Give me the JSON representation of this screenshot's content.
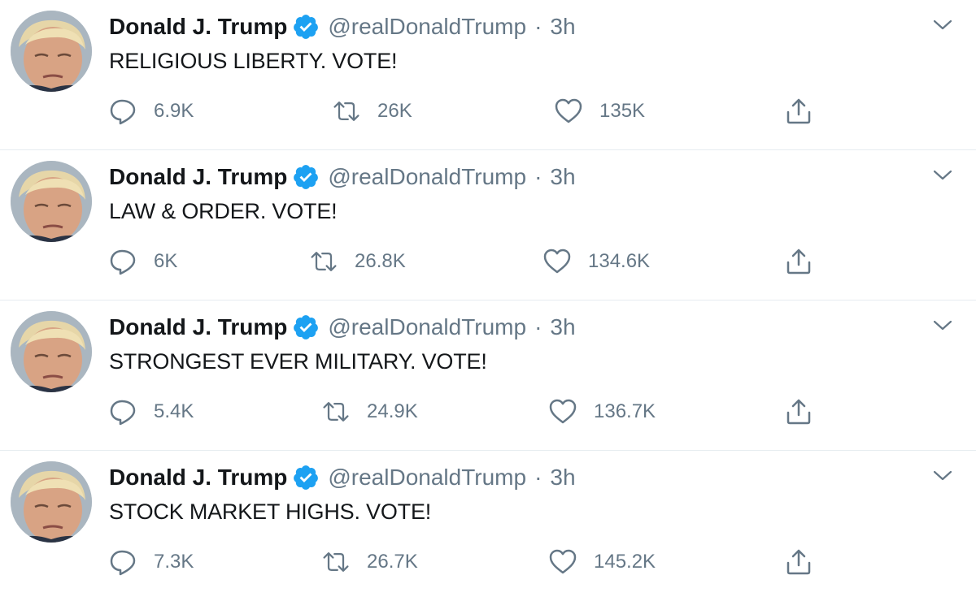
{
  "colors": {
    "text": "#14171a",
    "secondary": "#657786",
    "verified": "#1da1f2",
    "divider": "#e6ecf0"
  },
  "tweets": [
    {
      "name": "Donald J. Trump",
      "handle": "@realDonaldTrump",
      "separator": "·",
      "time": "3h",
      "text": "RELIGIOUS LIBERTY. VOTE!",
      "replies": "6.9K",
      "retweets": "26K",
      "likes": "135K"
    },
    {
      "name": "Donald J. Trump",
      "handle": "@realDonaldTrump",
      "separator": "·",
      "time": "3h",
      "text": "LAW & ORDER. VOTE!",
      "replies": "6K",
      "retweets": "26.8K",
      "likes": "134.6K"
    },
    {
      "name": "Donald J. Trump",
      "handle": "@realDonaldTrump",
      "separator": "·",
      "time": "3h",
      "text": "STRONGEST EVER MILITARY. VOTE!",
      "replies": "5.4K",
      "retweets": "24.9K",
      "likes": "136.7K"
    },
    {
      "name": "Donald J. Trump",
      "handle": "@realDonaldTrump",
      "separator": "·",
      "time": "3h",
      "text": "STOCK MARKET HIGHS. VOTE!",
      "replies": "7.3K",
      "retweets": "26.7K",
      "likes": "145.2K"
    }
  ]
}
